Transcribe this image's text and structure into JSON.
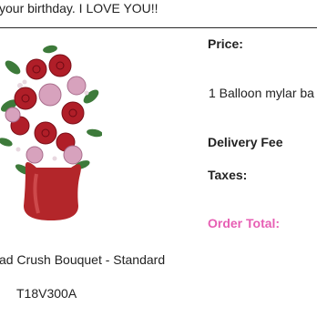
{
  "card_message": "your birthday. I LOVE YOU!!",
  "product": {
    "image_description": "red roses and pink roses bouquet in a red vase",
    "name": "ad Crush Bouquet - Standard",
    "code": "T18V300A"
  },
  "summary": {
    "price_label": "Price:",
    "item_description": "1 Balloon mylar ba",
    "delivery_fee_label": "Delivery Fee",
    "taxes_label": "Taxes:",
    "order_total_label": "Order Total:"
  },
  "colors": {
    "order_total": "#e75fb4",
    "vase": "#b3262a",
    "divider": "#2b2b2b"
  }
}
